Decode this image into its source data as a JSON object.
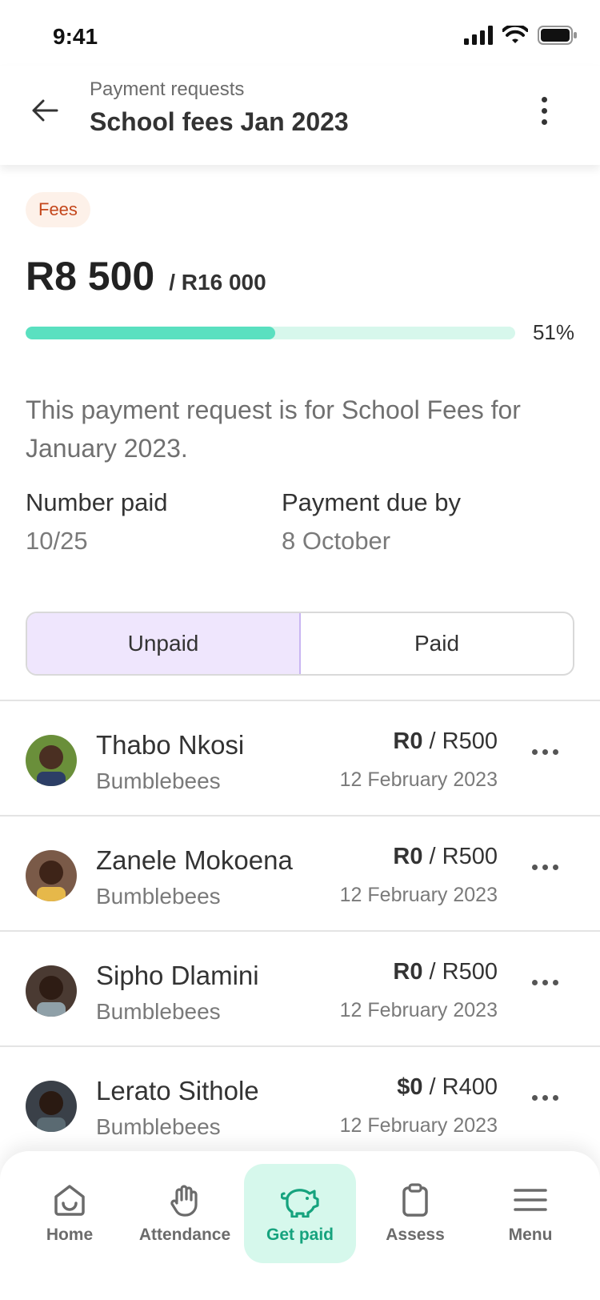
{
  "status_bar": {
    "time": "9:41"
  },
  "header": {
    "subtitle": "Payment requests",
    "title": "School fees Jan 2023"
  },
  "summary": {
    "tag": "Fees",
    "amount_paid": "R8 500",
    "amount_total": "/ R16 000",
    "progress_fraction": 0.51,
    "progress_label": "51%",
    "description": "This payment request is for School Fees for January 2023.",
    "number_paid_label": "Number paid",
    "number_paid_value": "10/25",
    "due_label": "Payment due by",
    "due_value": "8 October"
  },
  "tabs": [
    {
      "label": "Unpaid",
      "active": true
    },
    {
      "label": "Paid",
      "active": false
    }
  ],
  "children": [
    {
      "name": "Thabo Nkosi",
      "group": "Bumblebees",
      "paid": "R0",
      "total": "/ R500",
      "date": "12 February 2023",
      "avatar_color": "#6a8f3a"
    },
    {
      "name": "Zanele Mokoena",
      "group": "Bumblebees",
      "paid": "R0",
      "total": "/ R500",
      "date": "12 February 2023",
      "avatar_color": "#7a5a48"
    },
    {
      "name": "Sipho Dlamini",
      "group": "Bumblebees",
      "paid": "R0",
      "total": "/ R500",
      "date": "12 February 2023",
      "avatar_color": "#4a3a32"
    },
    {
      "name": "Lerato Sithole",
      "group": "Bumblebees",
      "paid": "$0",
      "total": "/ R400",
      "date": "12 February 2023",
      "avatar_color": "#3a4048"
    }
  ],
  "bottom_nav": [
    {
      "label": "Home",
      "icon": "home-icon",
      "active": false
    },
    {
      "label": "Attendance",
      "icon": "hand-icon",
      "active": false
    },
    {
      "label": "Get paid",
      "icon": "piggy-bank-icon",
      "active": true
    },
    {
      "label": "Assess",
      "icon": "clipboard-icon",
      "active": false
    },
    {
      "label": "Menu",
      "icon": "menu-icon",
      "active": false
    }
  ],
  "colors": {
    "accent": "#5ae0c0",
    "accent_light": "#d7f7ec",
    "tag_text": "#c4471c",
    "tag_bg": "#fdf1e9",
    "tab_active_bg": "#efe6fd",
    "nav_active": "#16a37e"
  }
}
